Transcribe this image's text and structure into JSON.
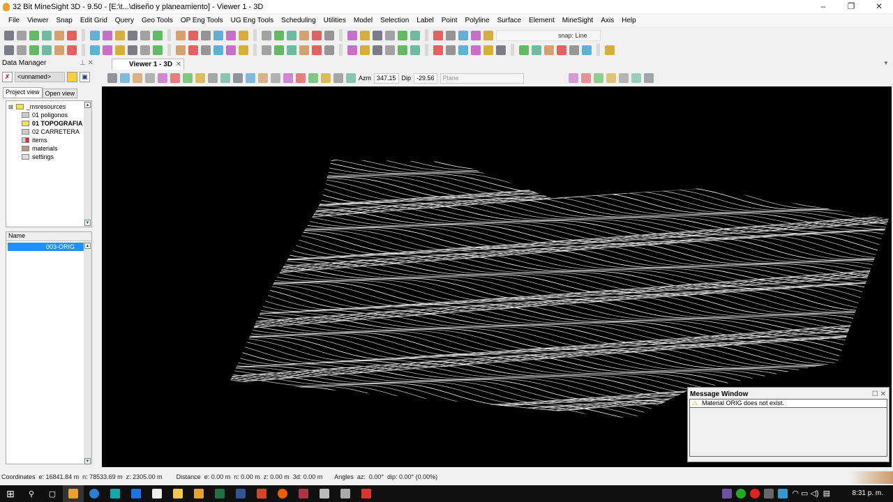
{
  "window": {
    "title": "32 Bit MineSight 3D  - 9.50 - [E:\\t...\\diseño y planeamiento] - Viewer 1 - 3D"
  },
  "menu": [
    "File",
    "Viewer",
    "Snap",
    "Edit Grid",
    "Query",
    "Geo Tools",
    "OP Eng Tools",
    "UG Eng Tools",
    "Scheduling",
    "Utilities",
    "Model",
    "Selection",
    "Label",
    "Point",
    "Polyline",
    "Surface",
    "Element",
    "MineSight",
    "Axis",
    "Help"
  ],
  "toolbar": {
    "snap": "snap: Line"
  },
  "data_manager": {
    "title": "Data Manager",
    "project": "<unnamed>",
    "tabs": [
      "Project view",
      "Open view"
    ],
    "tree": [
      "_msresources",
      "01 poligonos",
      "01 TOPOGRAFIA",
      "02 CARRETERA",
      "items",
      "materials",
      "settings"
    ],
    "name_header": "Name",
    "selected": "003-ORIG"
  },
  "viewer": {
    "tab": "Viewer 1 - 3D",
    "azm_label": "Azm",
    "azm": "347.15",
    "dip_label": "Dip",
    "dip": "-29.56",
    "plane": "Plane"
  },
  "message_window": {
    "title": "Message Window",
    "message": "Material ORIG does not exist."
  },
  "status": {
    "coordinates": "Coordinates  e: 16841.84 m  n: 78533.69 m  z: 2305.00 m",
    "distance": "Distance  e: 0.00 m  n: 0.00 m  z: 0.00 m  3d: 0.00 m",
    "angles": "Angles  az:  0.00°  dip: 0.00° (0.00%)"
  },
  "taskbar": {
    "clock": "8:31 p. m."
  }
}
